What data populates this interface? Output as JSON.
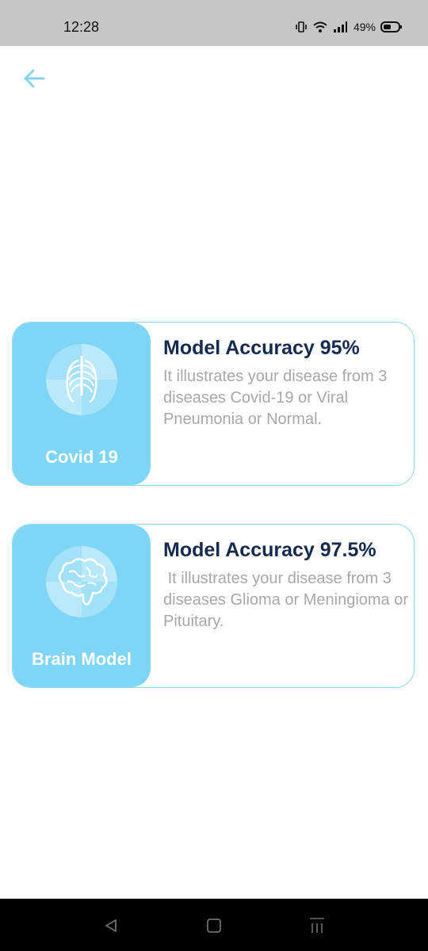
{
  "status_bar": {
    "time": "12:28",
    "battery": "49%",
    "icons": [
      "vibrate-icon",
      "wifi-icon",
      "signal-icon",
      "battery-icon"
    ]
  },
  "header": {
    "back_icon": "arrow-left-icon",
    "accent_color": "#8ad3ef"
  },
  "cards": [
    {
      "label": "Covid 19",
      "icon": "lungs-icon",
      "title": "Model Accuracy 95%",
      "description": "It illustrates your disease from 3 diseases Covid-19 or Viral  Pneumonia or Normal."
    },
    {
      "label": "Brain Model",
      "icon": "brain-icon",
      "title": "Model Accuracy 97.5%",
      "description": " It illustrates your disease from 3 diseases Glioma or Meningioma or Pituitary."
    }
  ],
  "colors": {
    "card_accent": "#7fd5f6",
    "card_border": "#8fd8ef",
    "title": "#152a4d",
    "description": "#a8a8a8"
  },
  "nav_bar": {
    "buttons": [
      "back-triangle-icon",
      "home-square-icon",
      "recents-lines-icon"
    ]
  }
}
